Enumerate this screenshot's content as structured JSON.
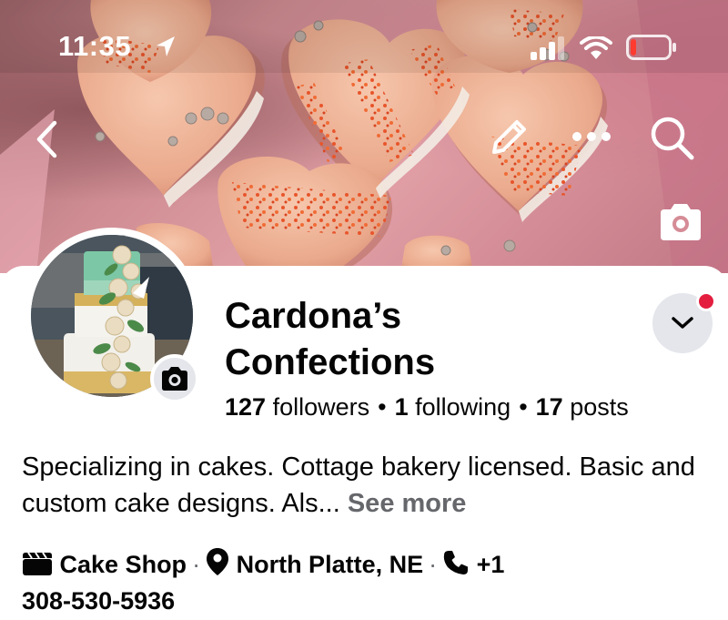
{
  "status_bar": {
    "time": "11:35",
    "icons": [
      "location-arrow-icon",
      "signal-icon",
      "wifi-icon",
      "battery-low-icon"
    ],
    "battery_level": 0.15
  },
  "cover": {
    "buttons": [
      "back-chevron-icon",
      "pencil-icon",
      "more-dots-icon",
      "search-icon",
      "camera-icon"
    ]
  },
  "profile": {
    "name_line1": "Cardona’s",
    "name_line2": "Confections",
    "followers_count": "127",
    "followers_label": "followers",
    "following_count": "1",
    "following_label": "following",
    "posts_count": "17",
    "posts_label": "posts",
    "separator": "•",
    "bio_text": "Specializing in cakes. Cottage bakery licensed. Basic and custom cake designs. Als...",
    "see_more": "See more",
    "category": "Cake Shop",
    "location": "North Platte, NE",
    "phone_prefix": "+1",
    "phone_number": "308-530-5936",
    "info_separator": "·"
  },
  "colors": {
    "text_primary": "#050505",
    "text_secondary": "#65676b",
    "button_bg": "#e4e6eb",
    "notification": "#e41e3f"
  }
}
